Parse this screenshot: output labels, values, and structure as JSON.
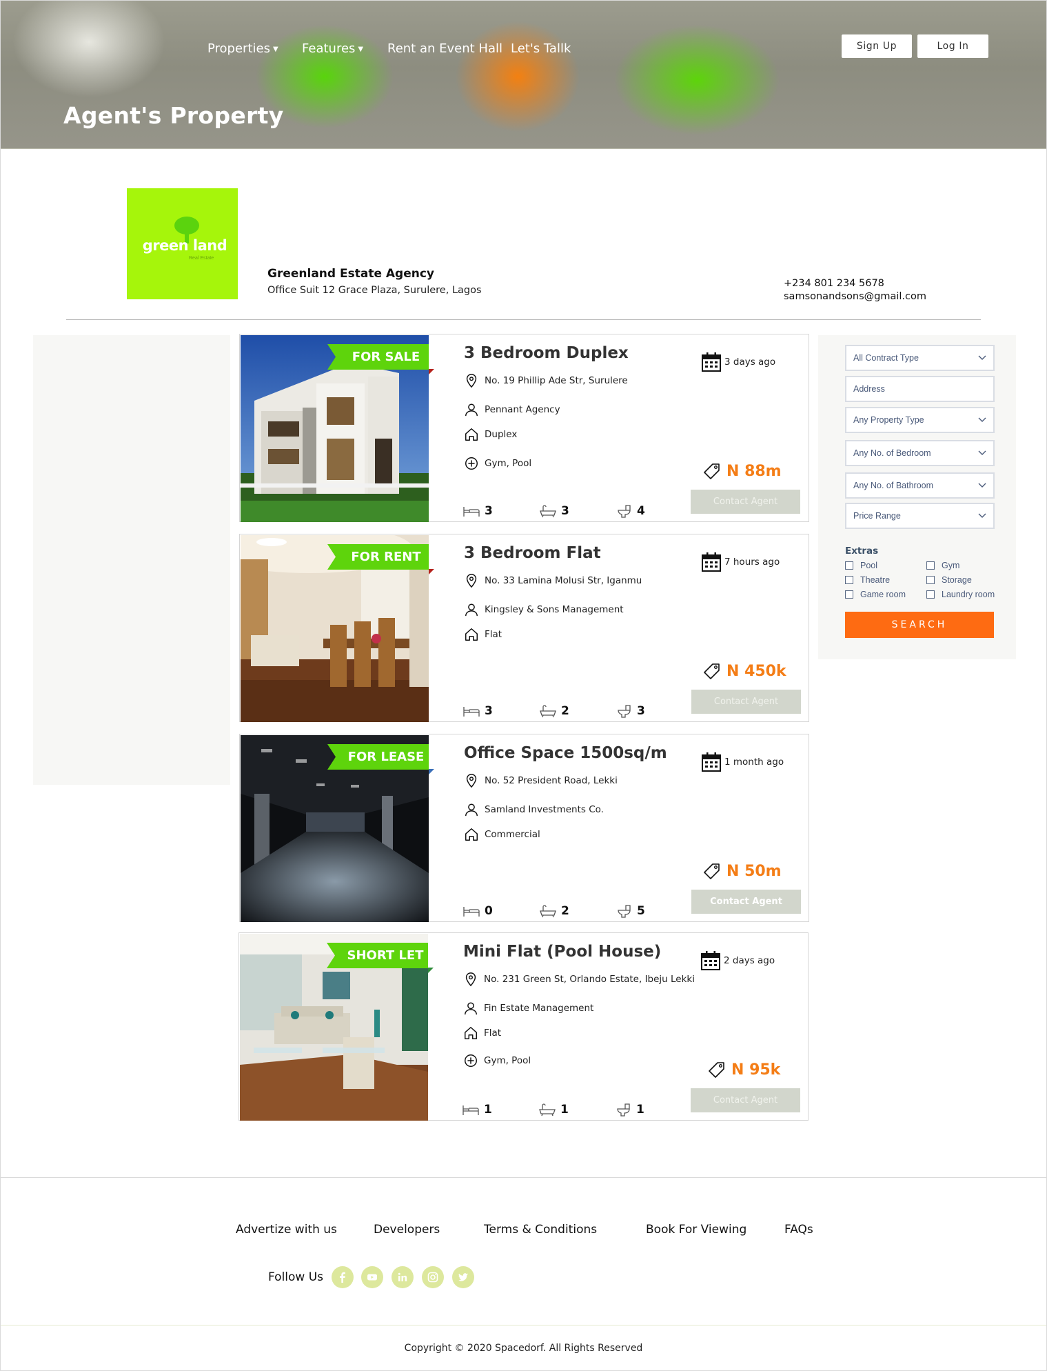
{
  "nav": {
    "properties": "Properties",
    "features": "Features",
    "rent_hall": "Rent an Event Hall",
    "lets_talk": "Let's Tallk",
    "sign_up": "Sign Up",
    "log_in": "Log In"
  },
  "hero": {
    "title": "Agent's Property"
  },
  "agent": {
    "logo_text": "green land",
    "logo_subtext": "Real Estate",
    "name": "Greenland Estate Agency",
    "address": "Office Suit 12 Grace Plaza, Surulere, Lagos",
    "phone": "+234 801 234 5678",
    "email": "samsonandsons@gmail.com"
  },
  "listings": [
    {
      "badge": "FOR SALE",
      "title": "3 Bedroom Duplex",
      "address": "No. 19 Phillip Ade Str, Surulere",
      "agent": "Pennant Agency",
      "type": "Duplex",
      "amenities": "Gym, Pool",
      "posted": "3 days ago",
      "price": "N 88m",
      "beds": "3",
      "baths": "3",
      "toilets": "4",
      "contact": "Contact Agent",
      "photo": "house"
    },
    {
      "badge": "FOR RENT",
      "title": "3 Bedroom Flat",
      "address": "No. 33 Lamina Molusi Str, Iganmu",
      "agent": "Kingsley & Sons Management",
      "type": "Flat",
      "amenities": "",
      "posted": "7 hours ago",
      "price": "N 450k",
      "beds": "3",
      "baths": "2",
      "toilets": "3",
      "contact": "Contact Agent",
      "photo": "dining"
    },
    {
      "badge": "FOR LEASE",
      "title": "Office Space 1500sq/m",
      "address": "No. 52 President Road, Lekki",
      "agent": "Samland Investments Co.",
      "type": "Commercial",
      "amenities": "",
      "posted": "1 month ago",
      "price": "N 50m",
      "beds": "0",
      "baths": "2",
      "toilets": "5",
      "contact": "Contact Agent",
      "photo": "office"
    },
    {
      "badge": "SHORT LET",
      "title": "Mini Flat (Pool House)",
      "address": "No. 231 Green St, Orlando Estate, Ibeju Lekki",
      "agent": "Fin Estate Management",
      "type": "Flat",
      "amenities": "Gym, Pool",
      "posted": "2 days ago",
      "price": "N 95k",
      "beds": "1",
      "baths": "1",
      "toilets": "1",
      "contact": "Contact Agent",
      "photo": "living"
    }
  ],
  "search": {
    "contract_type": "All Contract Type",
    "address_placeholder": "Address",
    "property_type": "Any Property Type",
    "bedrooms": "Any No. of Bedroom",
    "bathrooms": "Any No. of Bathroom",
    "price_range": "Price Range",
    "extras_title": "Extras",
    "extras": [
      "Pool",
      "Theatre",
      "Game room",
      "Gym",
      "Storage",
      "Laundry room"
    ],
    "button": "SEARCH"
  },
  "footer": {
    "links": [
      "Advertize with us",
      "Developers",
      "Terms & Conditions",
      "Book For Viewing",
      "FAQs"
    ],
    "follow_us": "Follow Us",
    "social": [
      "facebook-icon",
      "youtube-icon",
      "linkedin-icon",
      "instagram-icon",
      "twitter-icon"
    ],
    "copyright": "Copyright © 2020 Spacedorf. All Rights Reserved"
  },
  "colors": {
    "accent_orange": "#fe6b12",
    "price_orange": "#f47d16",
    "ribbon_green": "#5ed40c",
    "logo_green": "#a6f50b",
    "social_bg": "#dde89d"
  }
}
